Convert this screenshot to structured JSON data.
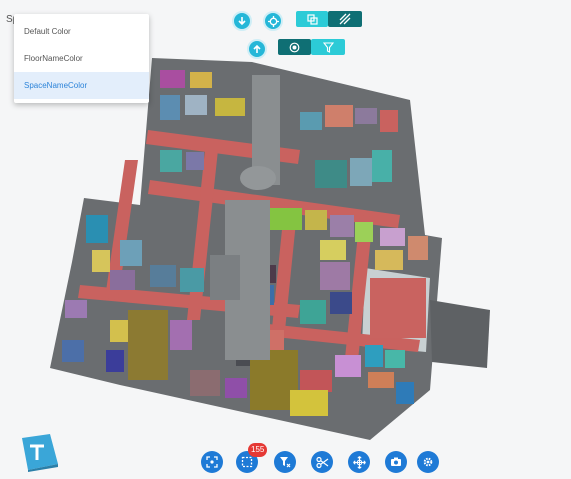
{
  "color_mode": {
    "field_label_partial": "Sp",
    "options": [
      "Default Color",
      "FloorNameColor",
      "SpaceNameColor"
    ],
    "selected": "SpaceNameColor"
  },
  "top_toolbar": {
    "icons": [
      "arrow-down-icon",
      "crosshair-icon",
      "copy-icon",
      "hatch-icon",
      "arrow-up-icon",
      "record-icon",
      "filter-icon"
    ]
  },
  "bottom_toolbar": {
    "selection_count": "155",
    "icons": [
      "focus-icon",
      "box-select-icon",
      "clear-filter-icon",
      "scissors-icon",
      "move-icon",
      "camera-icon",
      "settings-icon"
    ]
  },
  "colors": {
    "accent_teal": "#25b7d8",
    "dark_teal": "#0f6f74",
    "button_blue": "#1e7ad6",
    "badge_red": "#e53935",
    "corridor_red": "#c9625f"
  }
}
